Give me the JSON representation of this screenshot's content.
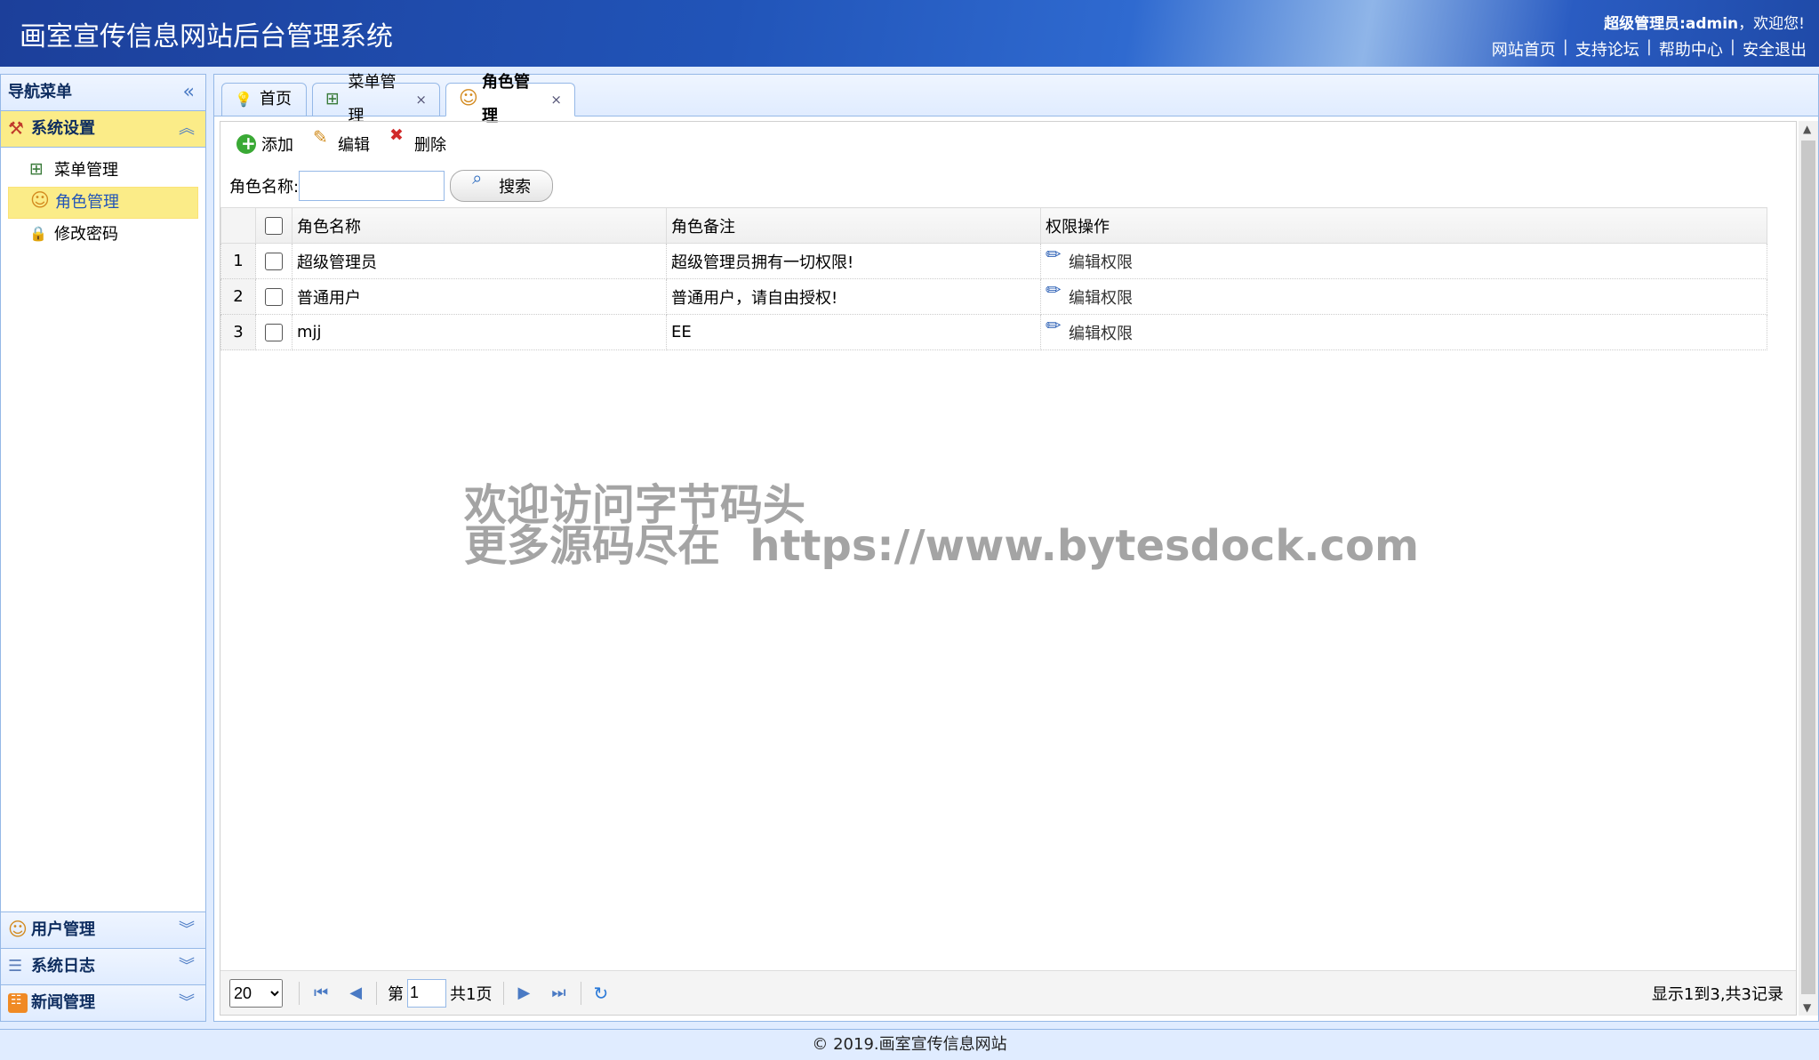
{
  "header": {
    "title": "画室宣传信息网站后台管理系统",
    "welcome_user": "超级管理员:admin",
    "welcome_suffix": "，欢迎您!",
    "links": [
      "网站首页",
      "支持论坛",
      "帮助中心",
      "安全退出"
    ]
  },
  "sidebar": {
    "title": "导航菜单",
    "groups": [
      {
        "label": "系统设置",
        "icon": "tools-icon",
        "expanded": true,
        "items": [
          {
            "label": "菜单管理",
            "icon": "tree-icon"
          },
          {
            "label": "角色管理",
            "icon": "users-icon",
            "selected": true
          },
          {
            "label": "修改密码",
            "icon": "lock-icon"
          }
        ]
      },
      {
        "label": "用户管理",
        "icon": "users-icon"
      },
      {
        "label": "系统日志",
        "icon": "log-icon"
      },
      {
        "label": "新闻管理",
        "icon": "rss-icon"
      }
    ]
  },
  "tabs": [
    {
      "label": "首页",
      "icon": "bulb-icon",
      "closable": false
    },
    {
      "label": "菜单管理",
      "icon": "tree-icon",
      "closable": true
    },
    {
      "label": "角色管理",
      "icon": "users-icon",
      "closable": true,
      "active": true
    }
  ],
  "tab_close": "×",
  "toolbar": {
    "add": "添加",
    "edit": "编辑",
    "delete": "删除"
  },
  "search": {
    "label": "角色名称:",
    "button": "搜索",
    "value": ""
  },
  "grid": {
    "columns": [
      "角色名称",
      "角色备注",
      "权限操作"
    ],
    "rows": [
      {
        "n": "1",
        "name": "超级管理员",
        "note": "超级管理员拥有一切权限!",
        "action": "编辑权限"
      },
      {
        "n": "2",
        "name": "普通用户",
        "note": "普通用户，请自由授权!",
        "action": "编辑权限"
      },
      {
        "n": "3",
        "name": "mjj",
        "note": "EE",
        "action": "编辑权限"
      }
    ]
  },
  "watermark": {
    "line1": "欢迎访问字节码头",
    "line2": "更多源码尽在  https://www.bytesdock.com"
  },
  "pager": {
    "page_size": "20",
    "page_prefix": "第",
    "page_value": "1",
    "page_total": "共1页",
    "info": "显示1到3,共3记录"
  },
  "footer": "© 2019.画室宣传信息网站"
}
